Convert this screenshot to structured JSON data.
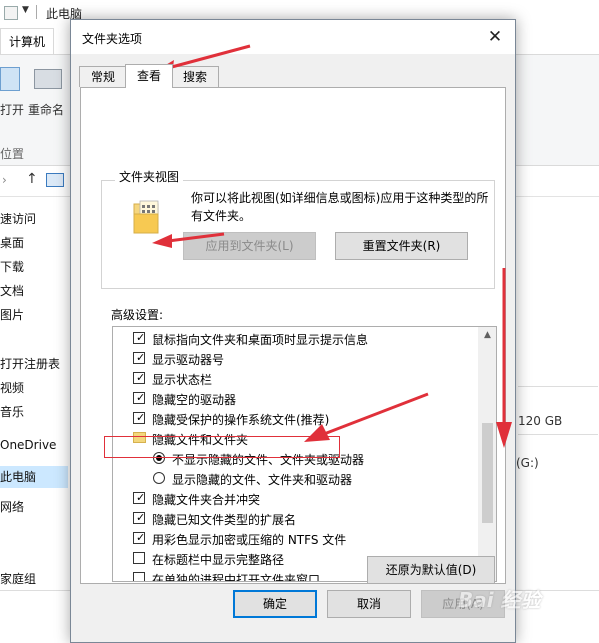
{
  "explorer": {
    "title": "此电脑",
    "tab": "计算机",
    "ribbon_btn1": "打开",
    "ribbon_btn2": "重命名",
    "ribbon_group": "位置",
    "nav_items": [
      "速访问",
      "桌面",
      "下载",
      "文档",
      "图片",
      "打开注册表",
      "视频",
      "音乐",
      "OneDrive",
      "此电脑",
      "网络",
      "家庭组"
    ],
    "disk_size": "120 GB",
    "drive_label": "(G:)"
  },
  "dialog": {
    "title": "文件夹选项",
    "close_glyph": "✕",
    "tabs": [
      "常规",
      "查看",
      "搜索"
    ],
    "active_tab": 1,
    "folder_view": {
      "group_title": "文件夹视图",
      "description": "你可以将此视图(如详细信息或图标)应用于这种类型的所有文件夹。",
      "apply_button": "应用到文件夹(L)",
      "reset_button": "重置文件夹(R)"
    },
    "advanced": {
      "label": "高级设置:",
      "items": [
        {
          "kind": "checkbox",
          "checked": true,
          "indent": 0,
          "text": "鼠标指向文件夹和桌面项时显示提示信息"
        },
        {
          "kind": "checkbox",
          "checked": true,
          "indent": 0,
          "text": "显示驱动器号"
        },
        {
          "kind": "checkbox",
          "checked": true,
          "indent": 0,
          "text": "显示状态栏"
        },
        {
          "kind": "checkbox",
          "checked": true,
          "indent": 0,
          "text": "隐藏空的驱动器"
        },
        {
          "kind": "checkbox",
          "checked": true,
          "indent": 0,
          "text": "隐藏受保护的操作系统文件(推荐)"
        },
        {
          "kind": "folder",
          "checked": false,
          "indent": 0,
          "text": "隐藏文件和文件夹"
        },
        {
          "kind": "radio",
          "checked": true,
          "indent": 1,
          "text": "不显示隐藏的文件、文件夹或驱动器"
        },
        {
          "kind": "radio",
          "checked": false,
          "indent": 1,
          "text": "显示隐藏的文件、文件夹和驱动器"
        },
        {
          "kind": "checkbox",
          "checked": true,
          "indent": 0,
          "text": "隐藏文件夹合并冲突"
        },
        {
          "kind": "checkbox",
          "checked": true,
          "indent": 0,
          "text": "隐藏已知文件类型的扩展名"
        },
        {
          "kind": "checkbox",
          "checked": true,
          "indent": 0,
          "text": "用彩色显示加密或压缩的 NTFS 文件"
        },
        {
          "kind": "checkbox",
          "checked": false,
          "indent": 0,
          "text": "在标题栏中显示完整路径"
        },
        {
          "kind": "checkbox",
          "checked": false,
          "indent": 0,
          "text": "在单独的进程中打开文件夹窗口"
        }
      ]
    },
    "restore_button": "还原为默认值(D)",
    "ok_button": "确定",
    "cancel_button": "取消",
    "apply_button": "应用(A)"
  },
  "watermark": "Bai 经验",
  "colors": {
    "annotation_red": "#e0303a",
    "focus_blue": "#0078d7"
  }
}
